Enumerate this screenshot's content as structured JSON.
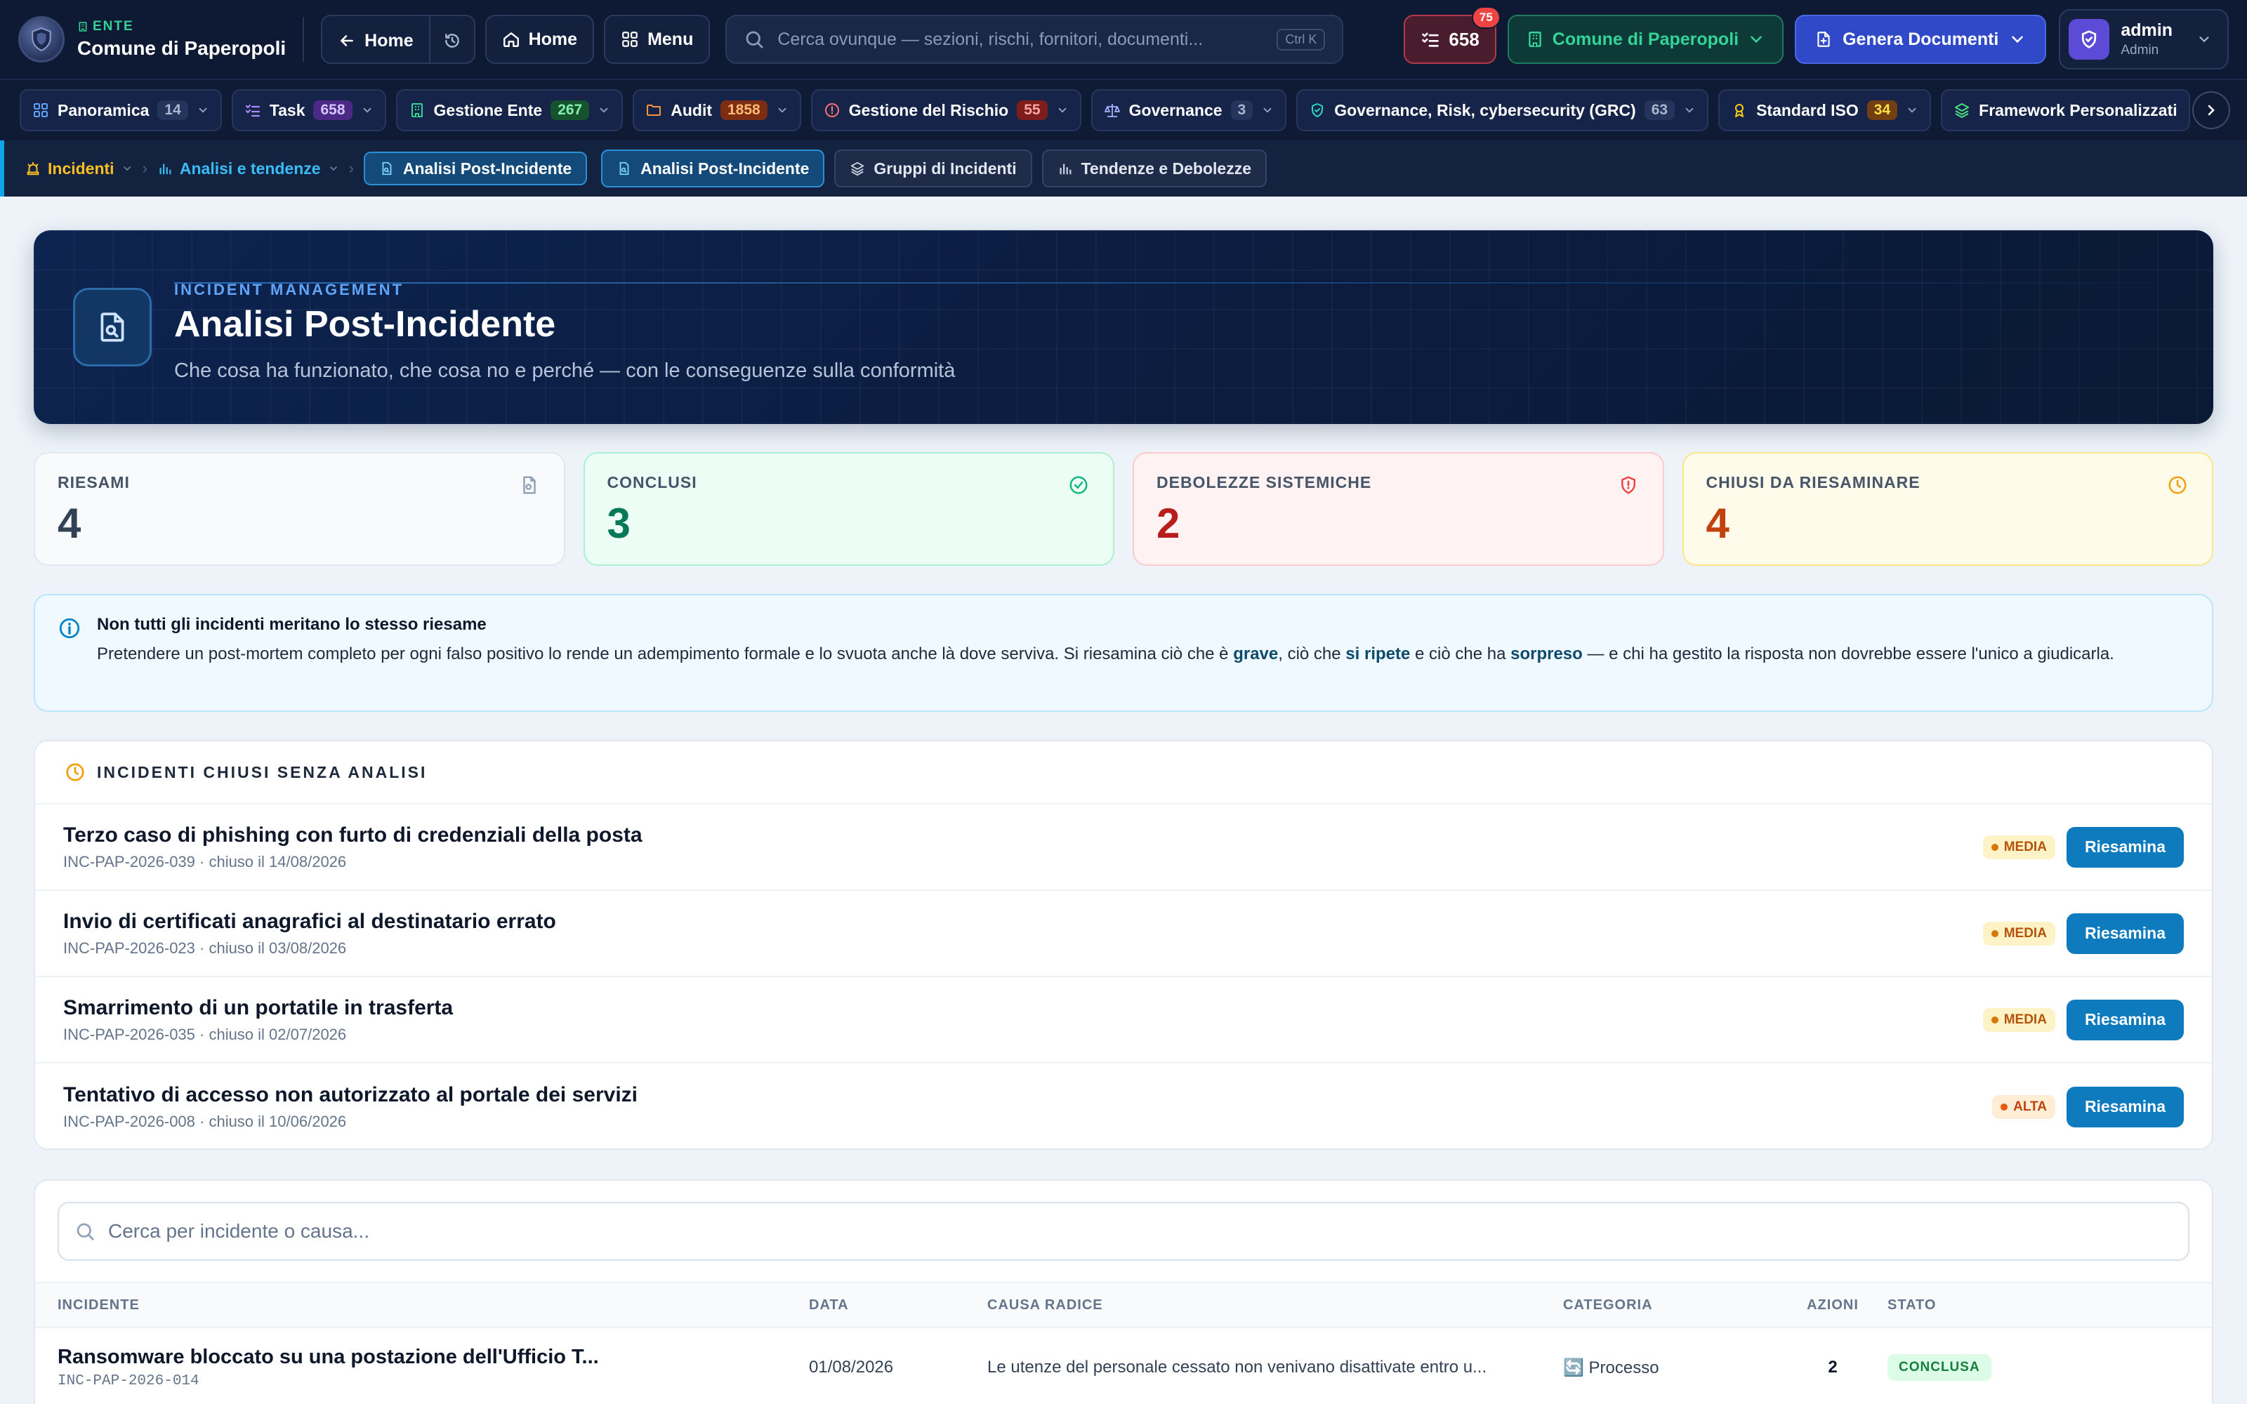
{
  "topbar": {
    "org_kicker": "ENTE",
    "org_name": "Comune di Paperopoli",
    "back_home": "Home",
    "home": "Home",
    "menu": "Menu",
    "search_placeholder": "Cerca ovunque — sezioni, rischi, fornitori, documenti...",
    "search_shortcut": "Ctrl K",
    "task_count": "658",
    "task_notifications": "75",
    "ente_selector": "Comune di Paperopoli",
    "generate_docs": "Genera Documenti",
    "user_name": "admin",
    "user_role": "Admin"
  },
  "modules": [
    {
      "label": "Panoramica",
      "count": "14",
      "icon": "grid-icon",
      "badge_bg": "#24345a",
      "badge_fg": "#aab6cf"
    },
    {
      "label": "Task",
      "count": "658",
      "icon": "checklist-icon",
      "badge_bg": "#4b2a86",
      "badge_fg": "#d8c6ff"
    },
    {
      "label": "Gestione Ente",
      "count": "267",
      "icon": "building-icon",
      "badge_bg": "#14532d",
      "badge_fg": "#86efac"
    },
    {
      "label": "Audit",
      "count": "1858",
      "icon": "folder-icon",
      "badge_bg": "#7c2d12",
      "badge_fg": "#fdba74"
    },
    {
      "label": "Gestione del Rischio",
      "count": "55",
      "icon": "alert-icon",
      "badge_bg": "#7f1d1d",
      "badge_fg": "#fca5a5"
    },
    {
      "label": "Governance",
      "count": "3",
      "icon": "scale-icon",
      "badge_bg": "#24345a",
      "badge_fg": "#aab6cf"
    },
    {
      "label": "Governance, Risk, cybersecurity (GRC)",
      "count": "63",
      "icon": "shield-check-icon",
      "badge_bg": "#24345a",
      "badge_fg": "#aab6cf"
    },
    {
      "label": "Standard ISO",
      "count": "34",
      "icon": "award-icon",
      "badge_bg": "#713f12",
      "badge_fg": "#fde047"
    },
    {
      "label": "Framework Personalizzati",
      "count": "",
      "icon": "layers-icon",
      "badge_bg": "",
      "badge_fg": ""
    }
  ],
  "breadcrumb": {
    "root": "Incidenti",
    "section": "Analisi e tendenze",
    "current": "Analisi Post-Incidente",
    "tabs": [
      "Analisi Post-Incidente",
      "Gruppi di Incidenti",
      "Tendenze e Debolezze"
    ]
  },
  "hero": {
    "kicker": "INCIDENT MANAGEMENT",
    "title": "Analisi Post-Incidente",
    "subtitle": "Che cosa ha funzionato, che cosa no e perché — con le conseguenze sulla conformità"
  },
  "kpis": [
    {
      "label": "RIESAMI",
      "value": "4",
      "color": "#334155",
      "icon": "doc-search-icon"
    },
    {
      "label": "CONCLUSI",
      "value": "3",
      "color": "#047857",
      "icon": "check-circle-icon"
    },
    {
      "label": "DEBOLEZZE SISTEMICHE",
      "value": "2",
      "color": "#b91c1c",
      "icon": "shield-alert-icon"
    },
    {
      "label": "CHIUSI DA RIESAMINARE",
      "value": "4",
      "color": "#c2410c",
      "icon": "clock-icon"
    }
  ],
  "info": {
    "title": "Non tutti gli incidenti meritano lo stesso riesame",
    "text_1": "Pretendere un post-mortem completo per ogni falso positivo lo rende un adempimento formale e lo svuota anche là dove serviva. Si riesamina ciò che è ",
    "strong_1": "grave",
    "text_2": ", ciò che ",
    "strong_2": "si ripete",
    "text_3": " e ciò che ha ",
    "strong_3": "sorpreso",
    "text_4": " — e chi ha gestito la risposta non dovrebbe essere l'unico a giudicarla."
  },
  "unreviewed": {
    "title": "INCIDENTI CHIUSI SENZA ANALISI",
    "action_label": "Riesamina",
    "items": [
      {
        "title": "Terzo caso di phishing con furto di credenziali della posta",
        "meta": "INC-PAP-2026-039 · chiuso il 14/08/2026",
        "severity": "MEDIA"
      },
      {
        "title": "Invio di certificati anagrafici al destinatario errato",
        "meta": "INC-PAP-2026-023 · chiuso il 03/08/2026",
        "severity": "MEDIA"
      },
      {
        "title": "Smarrimento di un portatile in trasferta",
        "meta": "INC-PAP-2026-035 · chiuso il 02/07/2026",
        "severity": "MEDIA"
      },
      {
        "title": "Tentativo di accesso non autorizzato al portale dei servizi",
        "meta": "INC-PAP-2026-008 · chiuso il 10/06/2026",
        "severity": "ALTA"
      }
    ]
  },
  "table": {
    "search_placeholder": "Cerca per incidente o causa...",
    "headers": [
      "INCIDENTE",
      "DATA",
      "CAUSA RADICE",
      "CATEGORIA",
      "AZIONI",
      "STATO"
    ],
    "rows": [
      {
        "incident": "Ransomware bloccato su una postazione dell'Ufficio T...",
        "code": "INC-PAP-2026-014",
        "date": "01/08/2026",
        "cause": "Le utenze del personale cessato non venivano disattivate entro u...",
        "category": "🔄 Processo",
        "actions": "2",
        "status": "CONCLUSA"
      }
    ]
  }
}
